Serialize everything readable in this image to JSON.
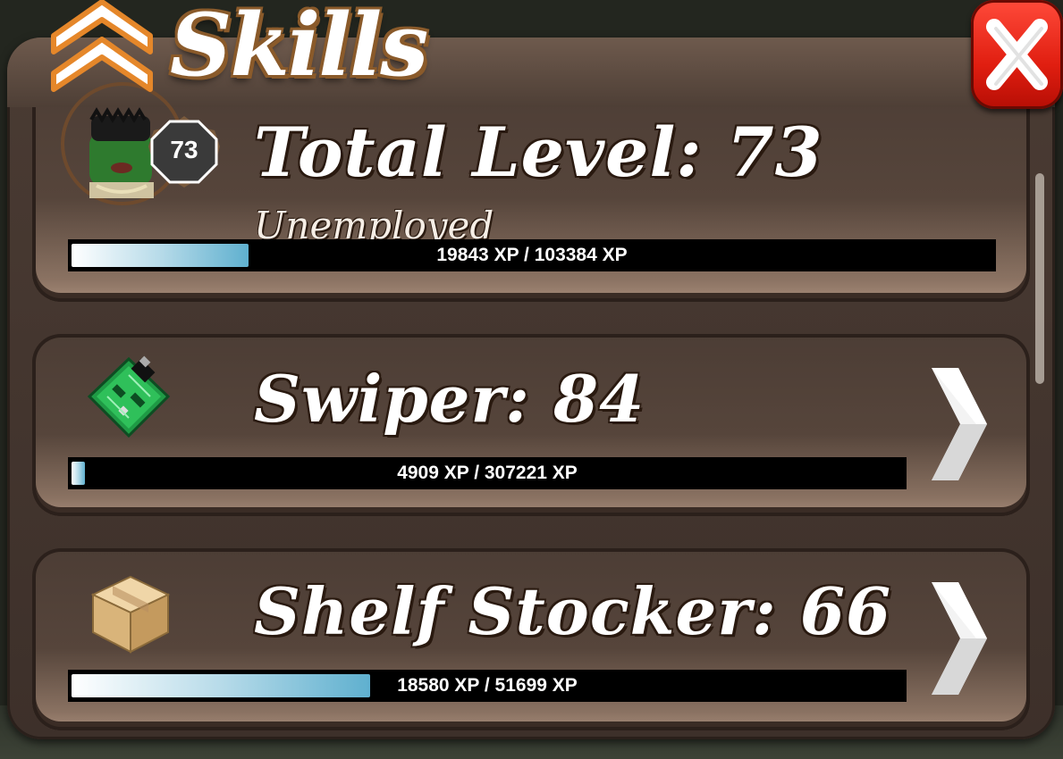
{
  "header": {
    "title": "Skills"
  },
  "total": {
    "title": "Total Level: 73",
    "level_badge": "73",
    "job": "Unemployed",
    "xp_text": "19843 XP / 103384 XP",
    "progress": 0.192
  },
  "skills": [
    {
      "title": "Swiper: 84",
      "xp_text": "4909 XP / 307221 XP",
      "progress": 0.016,
      "icon": "circuit-board-icon"
    },
    {
      "title": "Shelf Stocker: 66",
      "xp_text": "18580 XP / 51699 XP",
      "progress": 0.359,
      "icon": "cardboard-box-icon"
    }
  ],
  "colors": {
    "panel": "#3d302a",
    "close_button": "#e01e10",
    "bar_fill": "#5fb0cf",
    "title_outline": "#8a5a2a"
  }
}
